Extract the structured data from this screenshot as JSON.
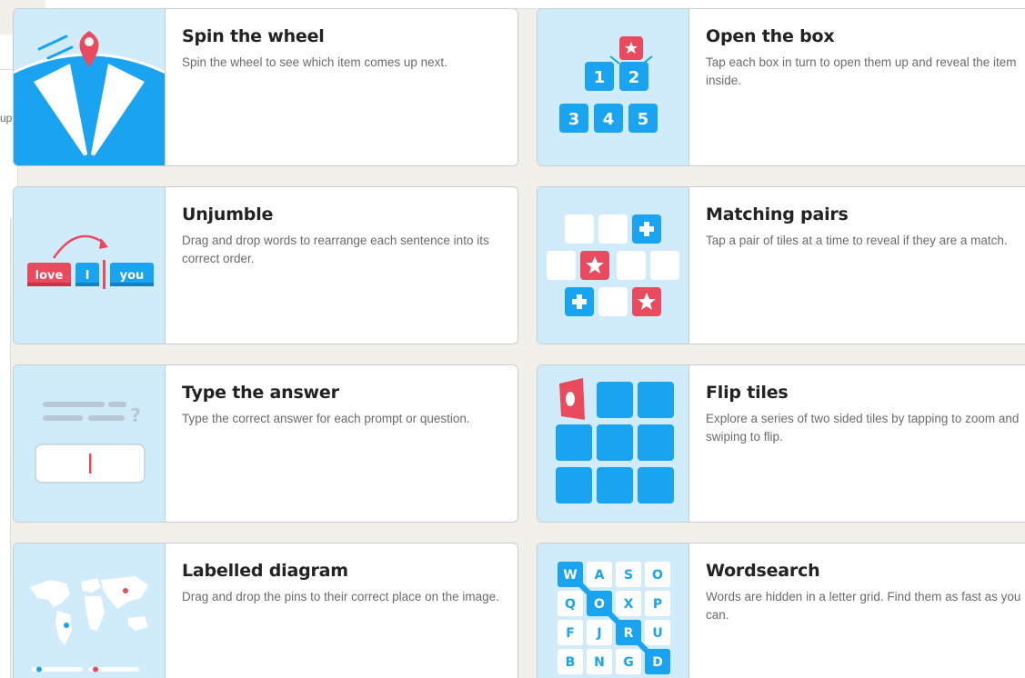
{
  "background": {
    "left_snippet": "up"
  },
  "templates": [
    {
      "id": "spin-the-wheel",
      "title": "Spin the wheel",
      "description": "Spin the wheel to see which item comes up next.",
      "icon": "spin-wheel-icon"
    },
    {
      "id": "open-the-box",
      "title": "Open the box",
      "description": "Tap each box in turn to open them up and reveal the item inside.",
      "icon": "open-box-icon",
      "box_numbers": [
        "1",
        "2",
        "3",
        "4",
        "5"
      ]
    },
    {
      "id": "unjumble",
      "title": "Unjumble",
      "description": "Drag and drop words to rearrange each sentence into its correct order.",
      "icon": "unjumble-icon",
      "words": [
        "love",
        "I",
        "you"
      ]
    },
    {
      "id": "matching-pairs",
      "title": "Matching pairs",
      "description": "Tap a pair of tiles at a time to reveal if they are a match.",
      "icon": "matching-pairs-icon"
    },
    {
      "id": "type-the-answer",
      "title": "Type the answer",
      "description": "Type the correct answer for each prompt or question.",
      "icon": "type-answer-icon",
      "prompt_mark": "?"
    },
    {
      "id": "flip-tiles",
      "title": "Flip tiles",
      "description": "Explore a series of two sided tiles by tapping to zoom and swiping to flip.",
      "icon": "flip-tiles-icon"
    },
    {
      "id": "labelled-diagram",
      "title": "Labelled diagram",
      "description": "Drag and drop the pins to their correct place on the image.",
      "icon": "labelled-diagram-icon"
    },
    {
      "id": "wordsearch",
      "title": "Wordsearch",
      "description": "Words are hidden in a letter grid. Find them as fast as you can.",
      "icon": "wordsearch-icon",
      "grid": [
        [
          "W",
          "A",
          "S",
          "O"
        ],
        [
          "Q",
          "O",
          "X",
          "P"
        ],
        [
          "F",
          "J",
          "R",
          "U"
        ],
        [
          "B",
          "N",
          "G",
          "D"
        ]
      ]
    }
  ],
  "colors": {
    "accent_blue": "#1aa3f0",
    "accent_red": "#ea4a5e",
    "thumb_bg": "#d0ecfb"
  }
}
